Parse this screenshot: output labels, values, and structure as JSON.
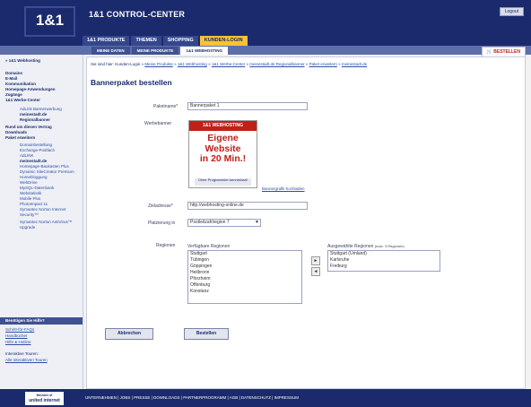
{
  "header": {
    "logo": "1&1",
    "title": "1&1 CONTROL-CENTER",
    "logout": "Logout",
    "nav": [
      {
        "label": "1&1 PRODUKTE",
        "active": false
      },
      {
        "label": "THEMEN",
        "active": false
      },
      {
        "label": "SHOPPING",
        "active": false
      },
      {
        "label": "KUNDEN-LOGIN",
        "active": true
      }
    ],
    "subtabs": [
      {
        "label": "MEINE DATEN",
        "active": false
      },
      {
        "label": "MEINE PRODUKTE",
        "active": false
      },
      {
        "label": "1&1 WEBHOSTING",
        "active": true
      }
    ],
    "order_button": "BESTELLEN"
  },
  "sidebar": {
    "items": [
      {
        "label": "» 1&1 Webhosting",
        "style": "bold"
      },
      {
        "label": "Domains",
        "style": "bold"
      },
      {
        "label": "E-Mail",
        "style": "bold"
      },
      {
        "label": "Kommunikation",
        "style": "bold"
      },
      {
        "label": "Homepage-Anwendungen",
        "style": "bold"
      },
      {
        "label": "Zugänge",
        "style": "bold"
      },
      {
        "label": "1&1 Werbe-Center",
        "style": "bold"
      },
      {
        "label": "AdLink Bannerwerbung",
        "style": "sub"
      },
      {
        "label": "meinestadt.de",
        "style": "subb"
      },
      {
        "label": "Regionalbanner",
        "style": "subb"
      },
      {
        "label": "Rund um diesen Vertrag",
        "style": "bold"
      },
      {
        "label": "Downloads",
        "style": "bold"
      },
      {
        "label": "Paket erweitern",
        "style": "bold"
      },
      {
        "label": "Domainbestellung",
        "style": "sub"
      },
      {
        "label": "Exchange-Postfach",
        "style": "sub"
      },
      {
        "label": "AdLINK",
        "style": "sub"
      },
      {
        "label": "meinestadt.de",
        "style": "subb"
      },
      {
        "label": "Homepage-Baukasten Plus",
        "style": "sub"
      },
      {
        "label": "Dynamic SiteCreator Premium",
        "style": "sub"
      },
      {
        "label": "Homebloggung",
        "style": "sub"
      },
      {
        "label": "WebDrive",
        "style": "sub"
      },
      {
        "label": "MySQL-Datenbank",
        "style": "sub"
      },
      {
        "label": "Webstatistik",
        "style": "sub"
      },
      {
        "label": "Mobile Plus",
        "style": "sub"
      },
      {
        "label": "PhotoImpact 11",
        "style": "sub"
      },
      {
        "label": "Symantec Norton Internet",
        "style": "sub"
      },
      {
        "label": "Security™",
        "style": "sub"
      },
      {
        "label": "Symantec Norton AntiVirus™",
        "style": "sub"
      },
      {
        "label": "Upgrade",
        "style": "sub"
      }
    ],
    "help_title": "Benötigen Sie Hilfe?",
    "help_links": [
      "Schritt-für-FAQs",
      "Handbücher",
      "Hilfe & Hotline"
    ],
    "tours_text": "Interaktive Touren:",
    "tours_link": "Alle interaktiven Touren"
  },
  "main": {
    "breadcrumb_prefix": "Sie sind hier: Kunden-Login",
    "breadcrumb_links": [
      "Meine Produkte",
      "1&1 Webhosting",
      "1&1 Werbe-Center",
      "meinestadt.de Regionalbanner",
      "Paket erweitern",
      "meinestadt.de"
    ],
    "title": "Bannerpaket bestellen",
    "fields": {
      "paketname_label": "Paketname*",
      "paketname_value": "Bannerpaket 1",
      "werbebanner_label": "Werbebanner",
      "zieladresse_label": "Zieladresse*",
      "zieladresse_value": "http://webhosting-online.de",
      "platzierung_label": "Platzierung in",
      "platzierung_value": "Postleitzahlregion 7",
      "regionen_label": "Regionen"
    },
    "banner": {
      "top": "1&1 WEBHOSTING",
      "line1": "Eigene",
      "line2": "Website",
      "line3": "in 20 Min.!",
      "foot": "Ohne Programmier-kenntnisse!"
    },
    "banner_link": "Bannergrafik hochladen",
    "available_regions_label": "Verfügbare Regionen",
    "available_regions": [
      "Stuttgart",
      "Tübingen",
      "Göppingen",
      "Heilbronn",
      "Pforzheim",
      "Offenburg",
      "Konstanz"
    ],
    "selected_regions_label": "Ausgewählte Regionen",
    "selected_regions_note": "(max. 3 Regionen)",
    "selected_regions": [
      "Stuttgart (Umland)",
      "Karlsruhe",
      "Freiburg"
    ],
    "arrow_add": "►",
    "arrow_remove": "◄",
    "cancel_button": "Abbrechen",
    "submit_button": "Bestellen"
  },
  "footer": {
    "logo_line1": "Member of",
    "logo_line2": "united internet",
    "links": "UNTERNEHMEN | JOBS | PRESSE | DOWNLOADS | PARTNERPROGRAMM | AGB | DATENSCHUTZ | IMPRESSUM"
  }
}
